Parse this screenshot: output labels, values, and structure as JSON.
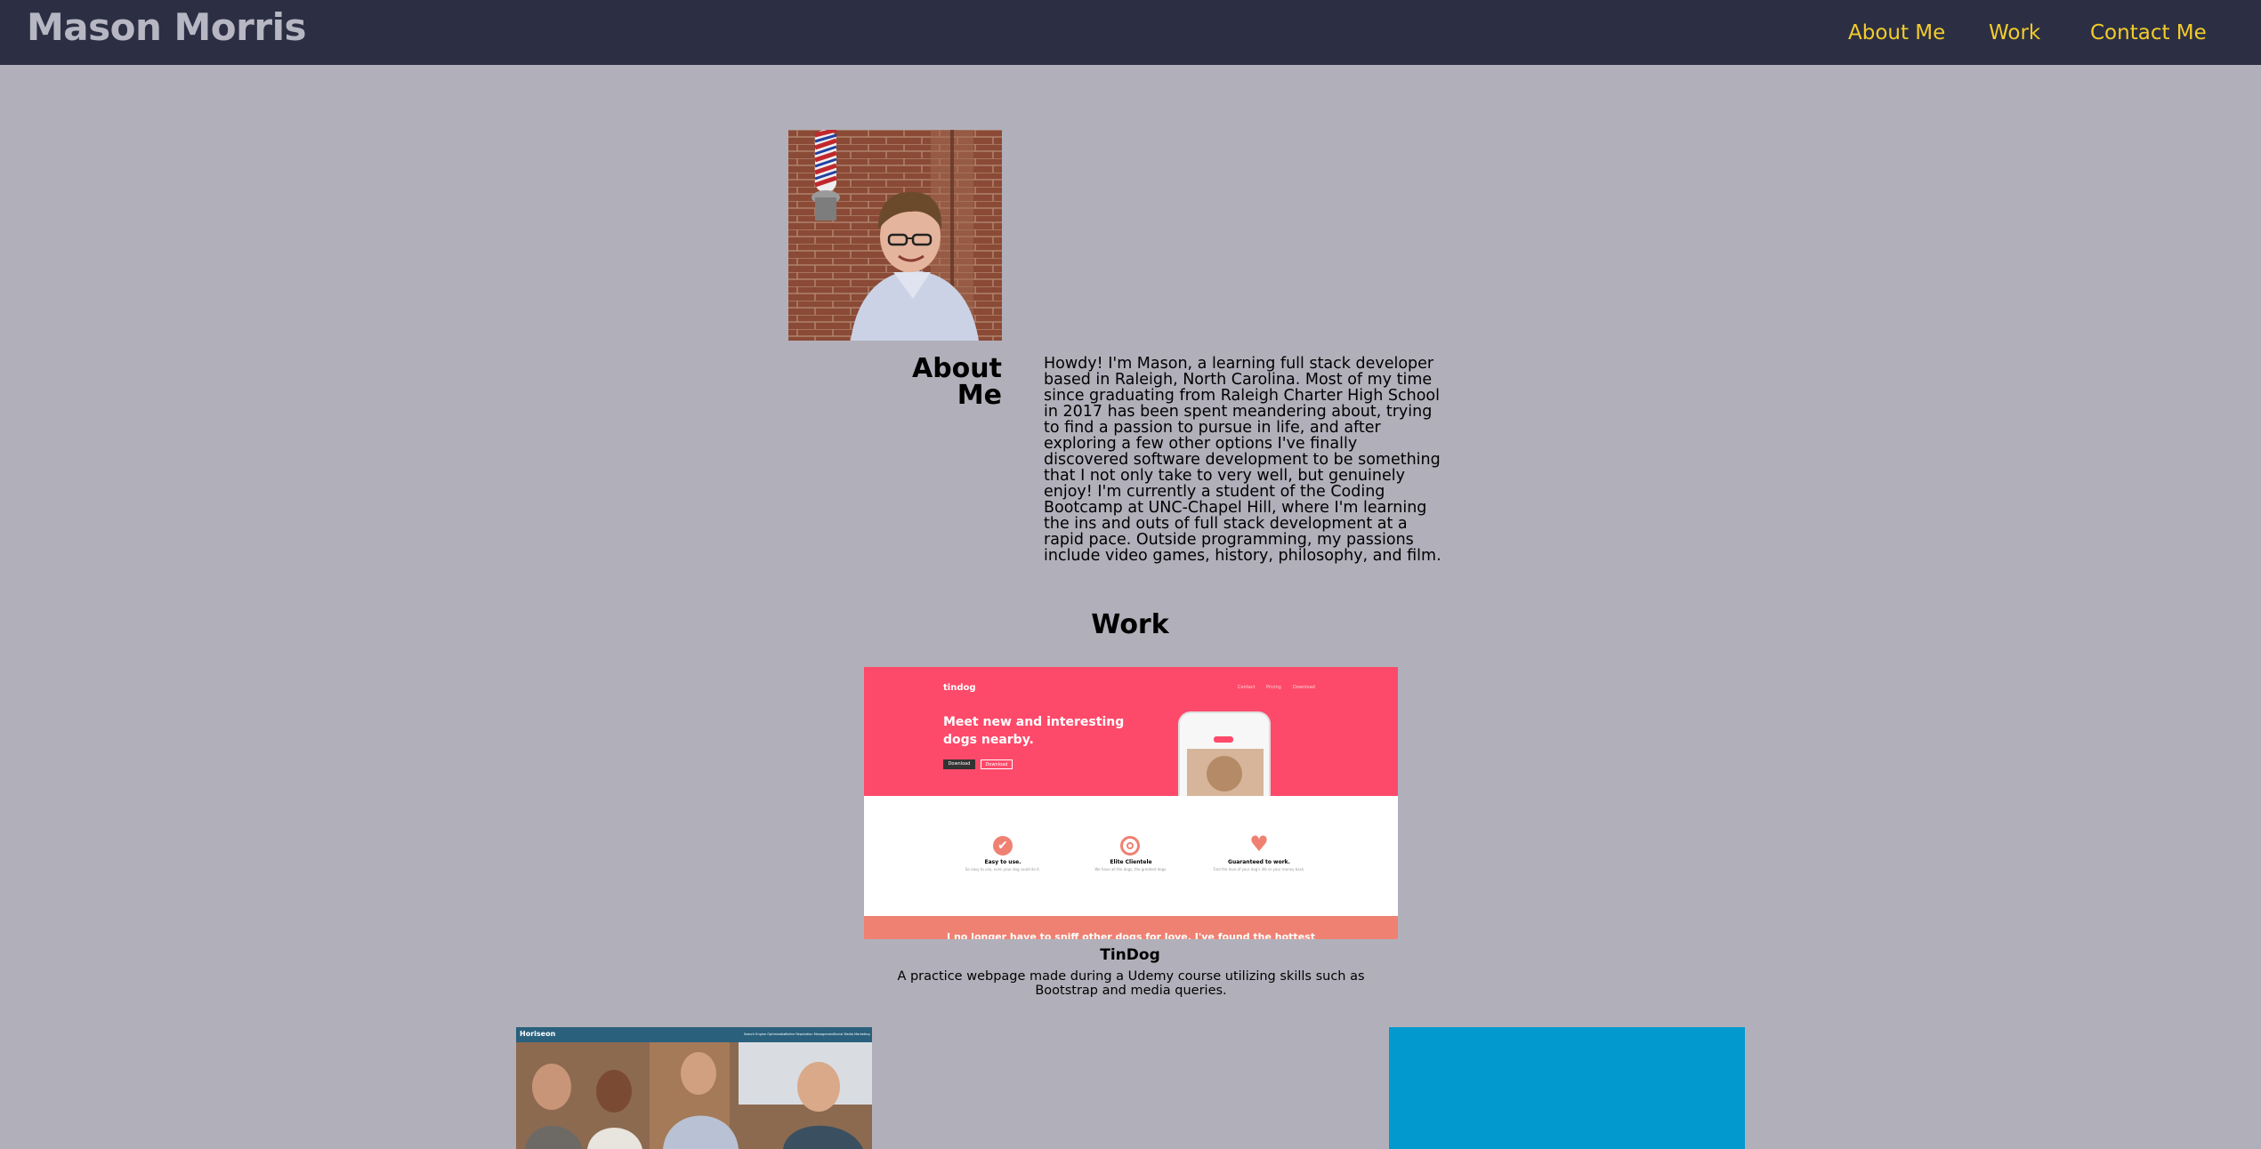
{
  "header": {
    "brand": "Mason Morris",
    "nav": [
      {
        "label": "About Me"
      },
      {
        "label": "Work"
      },
      {
        "label": "Contact Me"
      }
    ]
  },
  "about": {
    "heading": "About Me",
    "text": "Howdy! I'm Mason, a learning full stack developer based in Raleigh, North Carolina. Most of my time since graduating from Raleigh Charter High School in 2017 has been spent meandering about, trying to find a passion to pursue in life, and after exploring a few other options I've finally discovered software development to be something that I not only take to very well, but genuinely enjoy! I'm currently a student of the Coding Bootcamp at UNC-Chapel Hill, where I'm learning the ins and outs of full stack development at a rapid pace. Outside programming, my passions include video games, history, philosophy, and film."
  },
  "work": {
    "heading": "Work",
    "projects": [
      {
        "title": "TinDog",
        "description": "A practice webpage made during a Udemy course utilizing skills such as Bootstrap and media queries.",
        "screenshot": {
          "logo": "tindog",
          "nav": [
            "Contact",
            "Pricing",
            "Download"
          ],
          "headline": "Meet new and interesting dogs nearby.",
          "buttons": [
            "Download",
            "Download"
          ],
          "features": [
            {
              "icon": "check-circle-icon",
              "title": "Easy to use.",
              "text": "So easy to use, even your dog could do it."
            },
            {
              "icon": "target-icon",
              "title": "Elite Clientele",
              "text": "We have all the dogs, the greatest dogs."
            },
            {
              "icon": "heart-icon",
              "title": "Guaranteed to work.",
              "text": "Find the love of your dog's life or your money back."
            }
          ],
          "banner": "I no longer have to sniff other dogs for love. I've found the hottest",
          "accent": "#fe4a6a"
        }
      },
      {
        "screenshot": {
          "logo": "Horiseon",
          "nav": [
            "Search Engine Optimization",
            "Online Reputation Management",
            "Social Media Marketing"
          ]
        }
      },
      {
        "screenshot": {}
      }
    ]
  },
  "colors": {
    "background": "#b1b0ba",
    "navbar": "#2c2f44",
    "brand": "#b7b7c4",
    "nav_link": "#f2cc2a",
    "tindog_pink": "#fe4a6a",
    "project3_blue": "#0299cf"
  }
}
